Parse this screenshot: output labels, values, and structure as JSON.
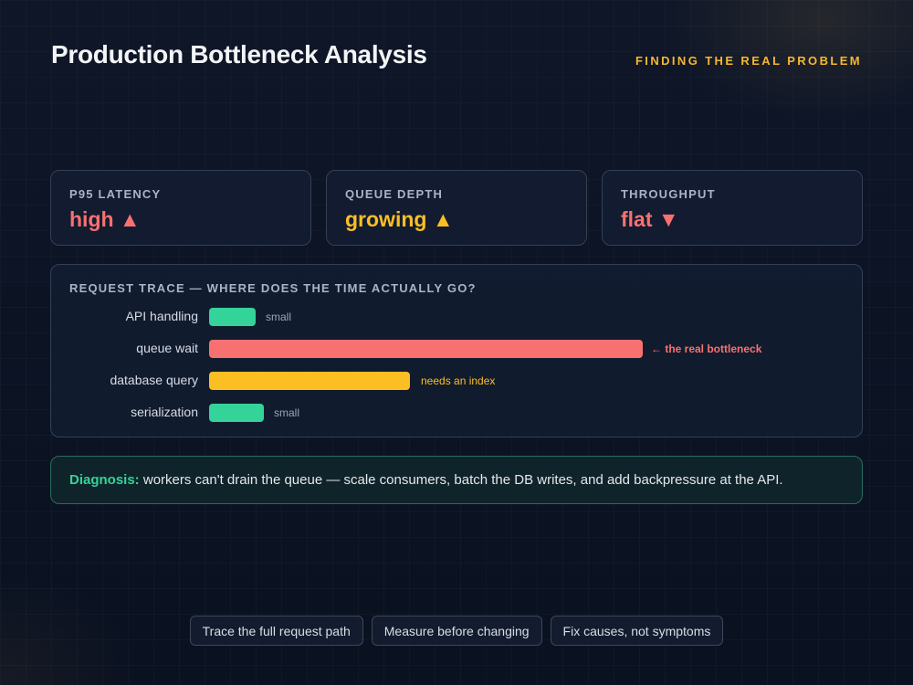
{
  "header": {
    "title": "Production Bottleneck Analysis",
    "subtitle": "FINDING THE REAL PROBLEM"
  },
  "metrics": [
    {
      "label": "P95 LATENCY",
      "value": "high ▲",
      "color": "#f87171"
    },
    {
      "label": "QUEUE DEPTH",
      "value": "growing ▲",
      "color": "#fbbf24"
    },
    {
      "label": "THROUGHPUT",
      "value": "flat ▼",
      "color": "#f87171"
    }
  ],
  "trace": {
    "title": "REQUEST TRACE — WHERE DOES THE TIME ACTUALLY GO?",
    "rows": [
      {
        "label": "API handling",
        "note": "small",
        "color": "#34d399",
        "note_color": "#9aa5b4"
      },
      {
        "label": "queue wait",
        "note": "← the real bottleneck",
        "color": "#f87171",
        "note_color": "#f87171"
      },
      {
        "label": "database query",
        "note": "needs an index",
        "color": "#fbbf24",
        "note_color": "#fbbf24"
      },
      {
        "label": "serialization",
        "note": "small",
        "color": "#34d399",
        "note_color": "#9aa5b4"
      }
    ]
  },
  "diagnosis": {
    "label": "Diagnosis:",
    "text": " workers can't drain the queue — scale consumers, batch the DB writes, and add backpressure at the API."
  },
  "chips": [
    "Trace the full request path",
    "Measure before changing",
    "Fix causes, not symptoms"
  ]
}
